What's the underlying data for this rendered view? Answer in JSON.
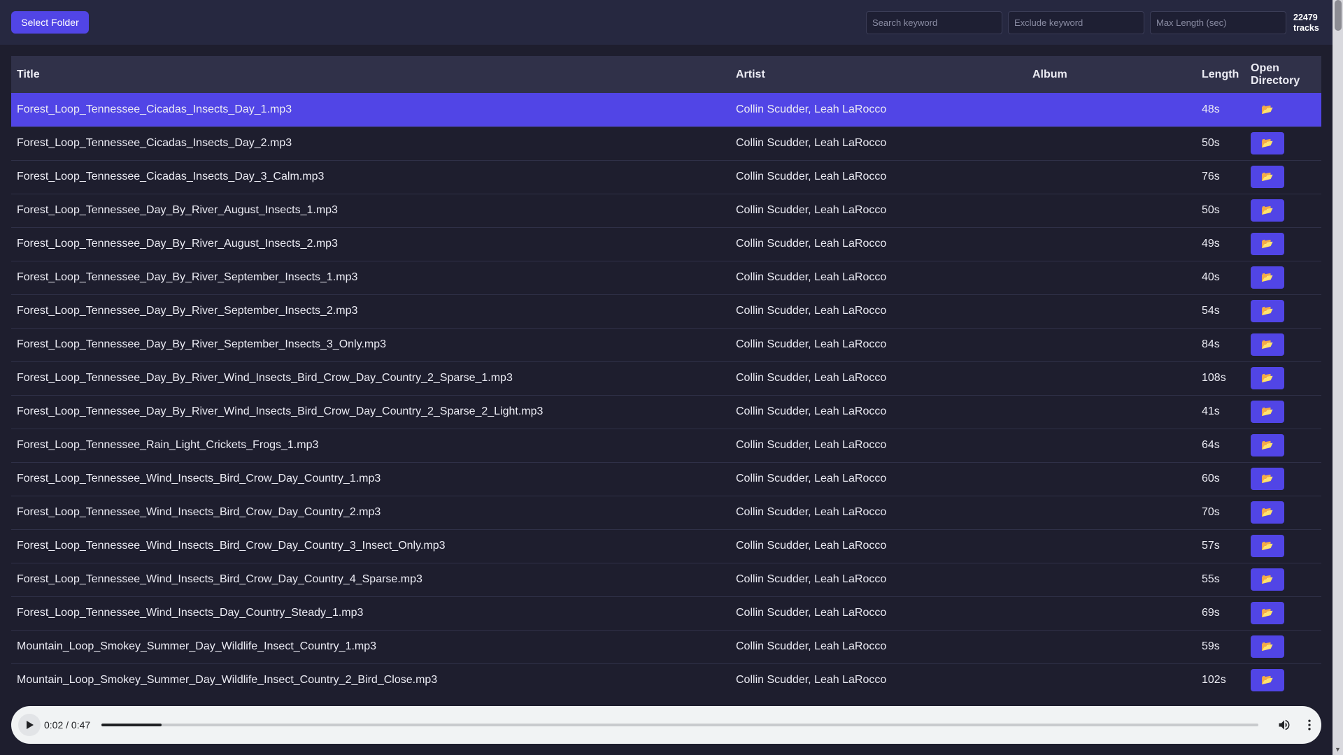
{
  "toolbar": {
    "select_folder_label": "Select Folder",
    "search_placeholder": "Search keyword",
    "exclude_placeholder": "Exclude keyword",
    "maxlen_placeholder": "Max Length (sec)",
    "track_count": "22479",
    "track_count_unit": "tracks"
  },
  "table": {
    "headers": {
      "title": "Title",
      "artist": "Artist",
      "album": "Album",
      "length": "Length",
      "open_dir": "Open Directory"
    },
    "rows": [
      {
        "title": "Forest_Loop_Tennessee_Cicadas_Insects_Day_1.mp3",
        "artist": "Collin Scudder, Leah LaRocco",
        "album": "",
        "length": "48s",
        "selected": true
      },
      {
        "title": "Forest_Loop_Tennessee_Cicadas_Insects_Day_2.mp3",
        "artist": "Collin Scudder, Leah LaRocco",
        "album": "",
        "length": "50s"
      },
      {
        "title": "Forest_Loop_Tennessee_Cicadas_Insects_Day_3_Calm.mp3",
        "artist": "Collin Scudder, Leah LaRocco",
        "album": "",
        "length": "76s"
      },
      {
        "title": "Forest_Loop_Tennessee_Day_By_River_August_Insects_1.mp3",
        "artist": "Collin Scudder, Leah LaRocco",
        "album": "",
        "length": "50s"
      },
      {
        "title": "Forest_Loop_Tennessee_Day_By_River_August_Insects_2.mp3",
        "artist": "Collin Scudder, Leah LaRocco",
        "album": "",
        "length": "49s"
      },
      {
        "title": "Forest_Loop_Tennessee_Day_By_River_September_Insects_1.mp3",
        "artist": "Collin Scudder, Leah LaRocco",
        "album": "",
        "length": "40s"
      },
      {
        "title": "Forest_Loop_Tennessee_Day_By_River_September_Insects_2.mp3",
        "artist": "Collin Scudder, Leah LaRocco",
        "album": "",
        "length": "54s"
      },
      {
        "title": "Forest_Loop_Tennessee_Day_By_River_September_Insects_3_Only.mp3",
        "artist": "Collin Scudder, Leah LaRocco",
        "album": "",
        "length": "84s"
      },
      {
        "title": "Forest_Loop_Tennessee_Day_By_River_Wind_Insects_Bird_Crow_Day_Country_2_Sparse_1.mp3",
        "artist": "Collin Scudder, Leah LaRocco",
        "album": "",
        "length": "108s"
      },
      {
        "title": "Forest_Loop_Tennessee_Day_By_River_Wind_Insects_Bird_Crow_Day_Country_2_Sparse_2_Light.mp3",
        "artist": "Collin Scudder, Leah LaRocco",
        "album": "",
        "length": "41s"
      },
      {
        "title": "Forest_Loop_Tennessee_Rain_Light_Crickets_Frogs_1.mp3",
        "artist": "Collin Scudder, Leah LaRocco",
        "album": "",
        "length": "64s"
      },
      {
        "title": "Forest_Loop_Tennessee_Wind_Insects_Bird_Crow_Day_Country_1.mp3",
        "artist": "Collin Scudder, Leah LaRocco",
        "album": "",
        "length": "60s"
      },
      {
        "title": "Forest_Loop_Tennessee_Wind_Insects_Bird_Crow_Day_Country_2.mp3",
        "artist": "Collin Scudder, Leah LaRocco",
        "album": "",
        "length": "70s"
      },
      {
        "title": "Forest_Loop_Tennessee_Wind_Insects_Bird_Crow_Day_Country_3_Insect_Only.mp3",
        "artist": "Collin Scudder, Leah LaRocco",
        "album": "",
        "length": "57s"
      },
      {
        "title": "Forest_Loop_Tennessee_Wind_Insects_Bird_Crow_Day_Country_4_Sparse.mp3",
        "artist": "Collin Scudder, Leah LaRocco",
        "album": "",
        "length": "55s"
      },
      {
        "title": "Forest_Loop_Tennessee_Wind_Insects_Day_Country_Steady_1.mp3",
        "artist": "Collin Scudder, Leah LaRocco",
        "album": "",
        "length": "69s"
      },
      {
        "title": "Mountain_Loop_Smokey_Summer_Day_Wildlife_Insect_Country_1.mp3",
        "artist": "Collin Scudder, Leah LaRocco",
        "album": "",
        "length": "59s"
      },
      {
        "title": "Mountain_Loop_Smokey_Summer_Day_Wildlife_Insect_Country_2_Bird_Close.mp3",
        "artist": "Collin Scudder, Leah LaRocco",
        "album": "",
        "length": "102s"
      }
    ],
    "open_dir_icon": "folder-icon"
  },
  "player": {
    "time_display": "0:02 / 0:47",
    "progress_fraction": 0.052,
    "play_icon": "play-icon",
    "volume_icon": "volume-icon",
    "more_icon": "more-vert-icon"
  },
  "colors": {
    "accent": "#5145e6",
    "background": "#1e1e2e",
    "header_bg": "#303149",
    "folder_glyph": "#f4b63f"
  }
}
